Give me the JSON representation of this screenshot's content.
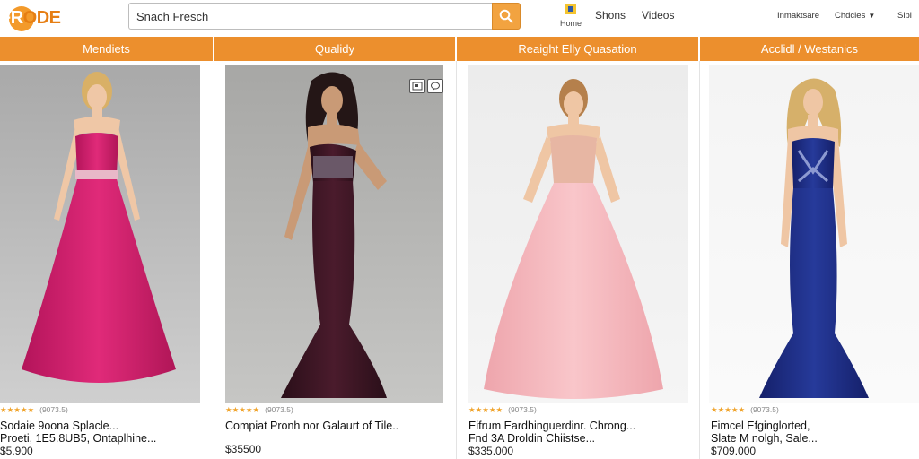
{
  "header": {
    "logo_first": "FR",
    "logo_rest": "ODE",
    "search_text": "Snach Fresch",
    "home_label": "Home",
    "nav": [
      "Shons",
      "Videos"
    ],
    "util": [
      "Inmaktsare",
      "Chdcles",
      "Sipi"
    ]
  },
  "categories": [
    "Mendiets",
    "Qualidy",
    "Reaight Elly Quasation",
    "Acclidl / Westanics"
  ],
  "products": [
    {
      "stars": "★★★★★",
      "rating_count": "(9073.5)",
      "title_line1": "Sodaie 9oona Splacle...",
      "title_line2": "Proeti, 1E5.8UB5, Ontaplhine...",
      "price": "$5.900"
    },
    {
      "stars": "★★★★★",
      "rating_count": "(9073.5)",
      "title_line1": "Compiat Pronh nor Galaurt of Tile..",
      "title_line2": "",
      "price": "$35500"
    },
    {
      "stars": "★★★★★",
      "rating_count": "(9073.5)",
      "title_line1": "Eifrum Eardhinguerdinr. Chrong...",
      "title_line2": "Fnd 3A Droldin Chiistse...",
      "price": "$335.000"
    },
    {
      "stars": "★★★★★",
      "rating_count": "(9073.5)",
      "title_line1": "Fimcel Efginglorted,",
      "title_line2": "Slate M nolgh, Sale...",
      "price": "$709.000"
    }
  ],
  "colors": {
    "accent": "#ec8f2d",
    "gown_magenta": "#d81f6f",
    "gown_plum": "#3b1624",
    "gown_blush": "#f6b8bd",
    "gown_navy": "#1f2e82",
    "star": "#f0a32a"
  },
  "icons": {
    "search": "search-icon",
    "home": "home-icon",
    "dropdown": "chevron-down-icon",
    "overlay": [
      "gallery-icon",
      "chat-icon"
    ]
  }
}
